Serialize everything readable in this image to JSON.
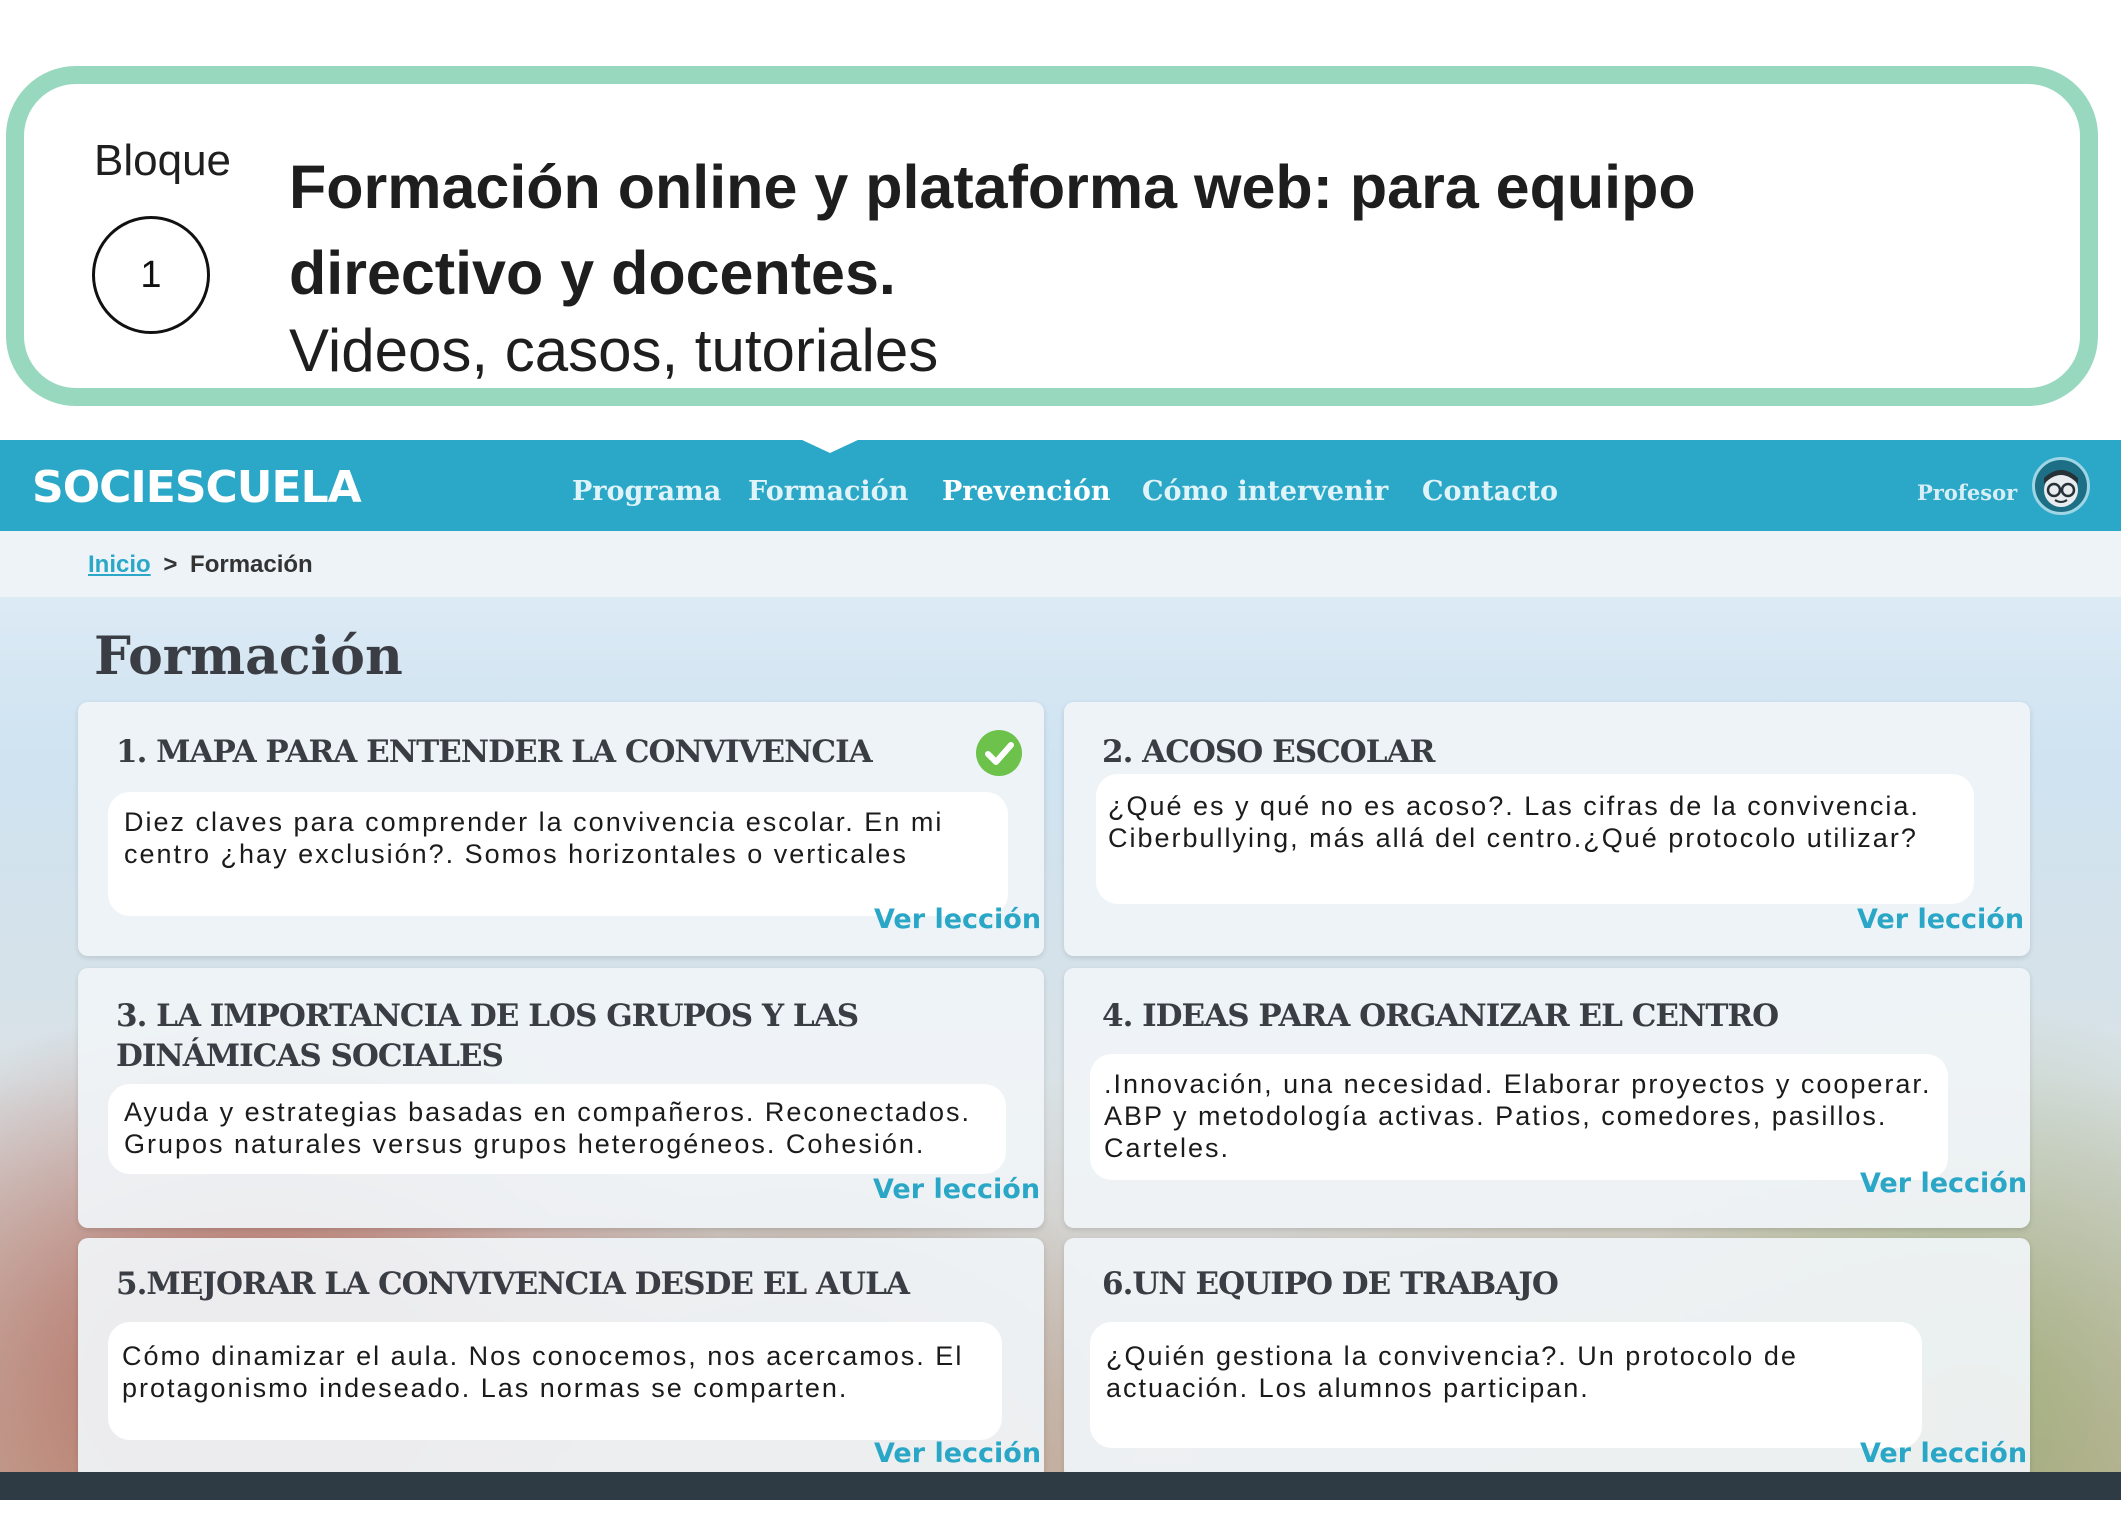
{
  "bloque": {
    "label": "Bloque",
    "number": "1",
    "title": "Formación online y plataforma  web: para equipo directivo y docentes.",
    "subtitle": "Videos, casos, tutoriales"
  },
  "site": {
    "logo": "SOCIESCUELA",
    "nav": [
      {
        "label": "Programa"
      },
      {
        "label": "Formación"
      },
      {
        "label": "Prevención"
      },
      {
        "label": "Cómo intervenir"
      },
      {
        "label": "Contacto"
      }
    ],
    "user_label": "Profesor",
    "breadcrumb": {
      "home": "Inicio",
      "separator": ">",
      "current": "Formación"
    },
    "page_title": "Formación",
    "link_label": "Ver lección",
    "colors": {
      "nav": "#2ba8c8",
      "check": "#6cc24a",
      "link": "#2aa7c6"
    },
    "cards": [
      {
        "title": "1. MAPA PARA ENTENDER LA CONVIVENCIA",
        "desc": "Diez claves para comprender la convivencia escolar. En mi centro ¿hay exclusión?. Somos horizontales o verticales",
        "completed": true
      },
      {
        "title": "2. ACOSO ESCOLAR",
        "desc": "¿Qué es y qué no es acoso?. Las cifras de la convivencia. Ciberbullying, más allá del centro.¿Qué protocolo utilizar?",
        "completed": false
      },
      {
        "title": "3. LA IMPORTANCIA DE LOS GRUPOS Y LAS DINÁMICAS SOCIALES",
        "desc": "Ayuda y estrategias basadas en compañeros. Reconectados. Grupos naturales versus grupos heterogéneos. Cohesión.",
        "completed": false
      },
      {
        "title": "4. IDEAS PARA ORGANIZAR EL CENTRO",
        "desc": ".Innovación, una necesidad. Elaborar proyectos y cooperar. ABP y metodología activas. Patios, comedores, pasillos. Carteles.",
        "completed": false
      },
      {
        "title": "5.MEJORAR LA CONVIVENCIA DESDE EL AULA",
        "desc": "Cómo dinamizar el aula. Nos conocemos, nos acercamos. El protagonismo indeseado. Las normas se comparten.",
        "completed": false
      },
      {
        "title": "6.UN EQUIPO DE TRABAJO",
        "desc": "¿Quién gestiona la convivencia?. Un protocolo de actuación. Los alumnos participan.",
        "completed": false
      }
    ]
  }
}
